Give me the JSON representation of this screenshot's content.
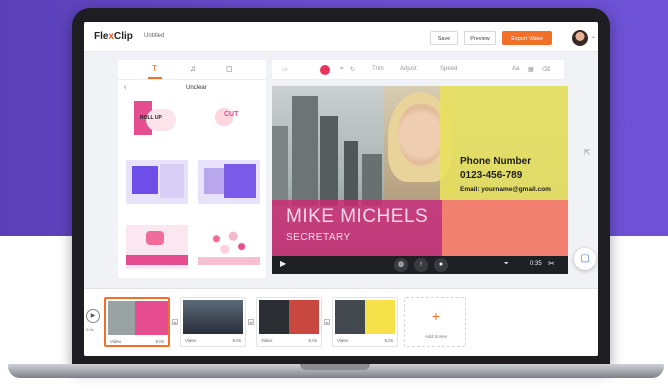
{
  "app": {
    "logo_prefix": "Fle",
    "logo_x": "x",
    "logo_suffix": "Clip",
    "document_title": "Untitled"
  },
  "header": {
    "save_label": "Save",
    "preview_label": "Preview",
    "export_label": "Export Video"
  },
  "panel": {
    "tabs": [
      {
        "icon": "text-icon",
        "glyph": "T"
      },
      {
        "icon": "music-icon",
        "glyph": "♫"
      },
      {
        "icon": "elements-icon",
        "glyph": "◻"
      }
    ],
    "back_glyph": "‹",
    "category_label": "Unclear",
    "templates": [
      {
        "caption": "Roll Up",
        "text": "ROLL UP"
      },
      {
        "caption": "Cut",
        "text": "CUT"
      },
      {
        "caption": "",
        "text": ""
      },
      {
        "caption": "",
        "text": ""
      },
      {
        "caption": "",
        "text": ""
      },
      {
        "caption": "",
        "text": ""
      }
    ]
  },
  "toolbar": {
    "items": [
      "Trim",
      "Adjust",
      "Speed"
    ]
  },
  "canvas": {
    "phone_label": "Phone Number",
    "phone_number": "0123-456-789",
    "email": "Email: yourname@gmail.com",
    "name": "MIKE MICHELS",
    "role": "SECRETARY",
    "colors": {
      "yellow_overlay": "#e8e05c",
      "magenta_overlay": "#ce2876",
      "coral_overlay": "#f28070"
    }
  },
  "player": {
    "time": "0:35"
  },
  "timeline": {
    "clips": [
      {
        "label": "Video",
        "duration": "8.0s"
      },
      {
        "label": "Video",
        "duration": "8.0s"
      },
      {
        "label": "Video",
        "duration": "5.0s"
      },
      {
        "label": "Video",
        "duration": "5.0s"
      }
    ],
    "add_scene_label": "Add Scene"
  },
  "accent_color": "#f0702a"
}
